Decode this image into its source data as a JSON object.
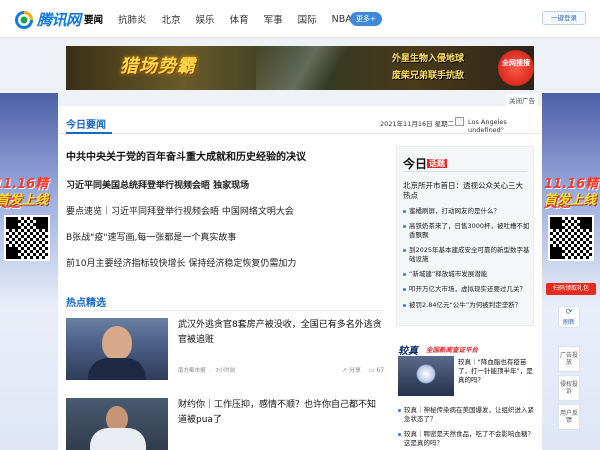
{
  "brand": {
    "logo_text": "腾讯网"
  },
  "nav": {
    "items": [
      "要闻",
      "抗肺炎",
      "北京",
      "娱乐",
      "体育",
      "军事",
      "国际",
      "NBA"
    ],
    "more_label": "更多+",
    "login_label": "一键登录"
  },
  "ad_banner": {
    "game_title": "猎场势霸",
    "tagline_1": "外星生物入侵地球",
    "tagline_2": "废柴兄弟联手抗敌",
    "cta": "全网搜搜",
    "close_label": "关闭广告"
  },
  "side_promo": {
    "left_date": "11.16精英之",
    "left_text": "首发上线",
    "right_date": "11.16精英之",
    "right_text": "首发上线",
    "right_button": "扫码领取礼包"
  },
  "main": {
    "tab_label": "今日要闻",
    "date": "2021年11月16日 星期二",
    "weather": "Los Angeles  undefined°"
  },
  "headlines": [
    "中共中央关于党的百年奋斗重大成就和历史经验的决议",
    "习近平同美国总统拜登举行视频会晤 独家现场",
    "要点速览｜习近平同拜登举行视频会晤 中国网络文明大会",
    "B张战\"疫\"速写画,每一张都是一个真实故事",
    "前10月主要经济指标较快增长 保持经济稳定恢复仍需加力"
  ],
  "hot": {
    "section_title": "热点精选",
    "cards": [
      {
        "title": "武汉外逃贪官8套房产被没收，全国已有多名外逃贪官被追赃",
        "source": "南方都市报",
        "time": "7小时前",
        "share": "分享",
        "comments": "67"
      },
      {
        "title": "财约你｜工作压抑，感情不顺？也许你自己都不知道被pua了",
        "source": "",
        "time": "",
        "share": "",
        "comments": ""
      }
    ]
  },
  "today_topic": {
    "header_main": "今日",
    "header_badge": "话题",
    "lead": "北京所开市首日：透视公众关心三大热点",
    "items": [
      "蜜橘刷屏，打动网友的是什么？",
      "高铁奶茶来了，日售3000杯，被吐槽不如香飘飘",
      "到2025年基本建成安全可靠的新型数字基础设施",
      "“新城建”释放城市发展潜能",
      "叩开万亿大市场，虚拟现实还要过几关？",
      "被罚2.84亿元“公牛”为何被判定垄断？"
    ]
  },
  "jiaozhen": {
    "header": "较真",
    "subheader": "全国新闻查证平台",
    "lead": "较真｜“降血脂也有疫苗了，打一针能顶半年”，是真的吗？",
    "items": [
      "较真｜神秘传染病在美国爆发，让组织进入紧急状态了？",
      "较真｜聘密是天然食品，吃了不会影响血糖？这是真的吗？"
    ]
  },
  "tools": {
    "refresh": "刷新",
    "items": [
      "广告投放",
      "侵权投诉",
      "用户反馈"
    ]
  }
}
